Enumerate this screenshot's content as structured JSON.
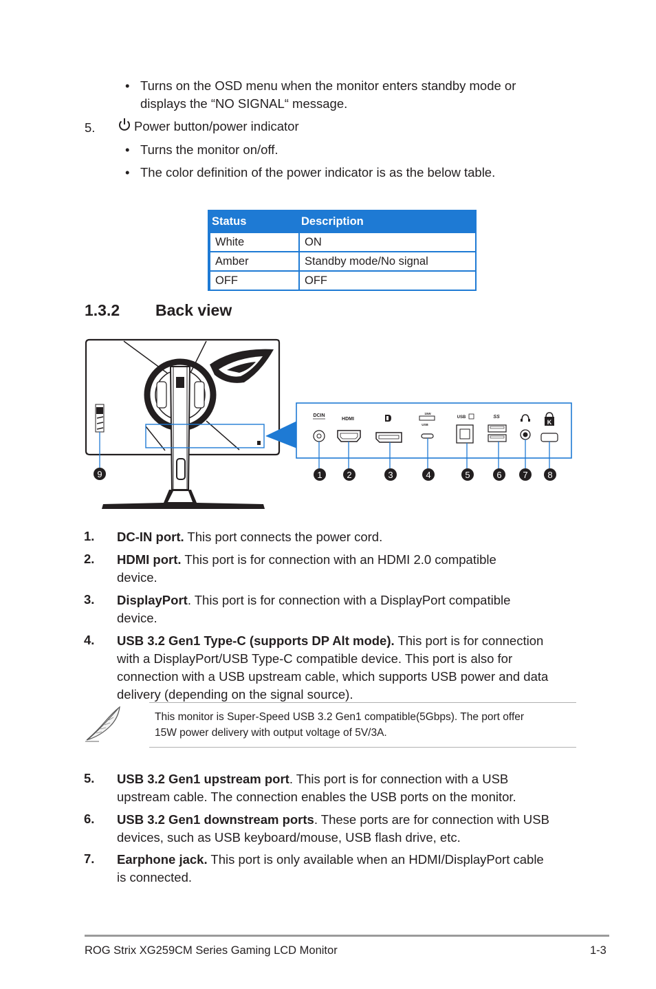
{
  "top_bullets": [
    {
      "symbol": "•",
      "lines": [
        "Turns on the OSD menu when the monitor enters standby mode or",
        "displays the “NO SIGNAL“ message."
      ]
    }
  ],
  "power_item": {
    "number": "5.",
    "icon": "power-icon",
    "label": "Power button/power indicator",
    "bullets": [
      {
        "symbol": "•",
        "text": "Turns the monitor on/off."
      },
      {
        "symbol": "•",
        "text": "The color definition of the power indicator is as the below table."
      }
    ]
  },
  "status_table": {
    "header": [
      "Status",
      "Description"
    ],
    "rows": [
      [
        "White",
        "ON"
      ],
      [
        "Amber",
        "Standby mode/No signal"
      ],
      [
        "OFF",
        "OFF"
      ]
    ],
    "header_color": "#1e7ad4"
  },
  "section": {
    "number": "1.3.2",
    "title": "Back view"
  },
  "diagram": {
    "port_labels": {
      "dcin": "DCIN",
      "hdmi": "HDMI",
      "dp": "DP",
      "typec_top": "15W",
      "typec_bottom": "USB",
      "usb_up": "USB",
      "usb_ss": "SS"
    },
    "callouts": [
      "1",
      "2",
      "3",
      "4",
      "5",
      "6",
      "7",
      "8",
      "9"
    ]
  },
  "items": [
    {
      "number": "1.",
      "bold": "DC-IN port.",
      "lines": [
        " This port connects the power cord."
      ]
    },
    {
      "number": "2.",
      "bold": "HDMI port.",
      "lines": [
        " This port is for connection with an HDMI 2.0 compatible",
        "device."
      ]
    },
    {
      "number": "3.",
      "bold": "DisplayPort",
      "lines": [
        ". This port is for connection with a DisplayPort compatible",
        "device."
      ]
    },
    {
      "number": "4.",
      "bold": "USB 3.2 Gen1 Type-C (supports DP Alt mode).",
      "lines": [
        " This port is for connection",
        "with a DisplayPort/USB Type-C compatible device. This port is also for",
        "connection with a USB upstream cable, which supports USB power and data",
        "delivery (depending on the signal source)."
      ]
    },
    {
      "number": "5.",
      "bold": "USB 3.2 Gen1 upstream port",
      "lines": [
        ". This port is for connection with a USB",
        "upstream cable. The connection enables the USB ports on the monitor."
      ]
    },
    {
      "number": "6.",
      "bold": "USB 3.2 Gen1 downstream ports",
      "lines": [
        ". These ports are for connection with USB",
        "devices, such as  USB keyboard/mouse, USB flash drive, etc."
      ]
    },
    {
      "number": "7.",
      "bold": "Earphone jack.",
      "lines": [
        " This port is only available when an HDMI/DisplayPort cable",
        "is connected."
      ]
    }
  ],
  "note": {
    "icon": "feather-pen-icon",
    "lines": [
      "This monitor is Super-Speed USB 3.2 Gen1 compatible(5Gbps). The port offer",
      "15W power delivery with output voltage of 5V/3A."
    ]
  },
  "footer": {
    "title": "ROG Strix XG259CM Series Gaming LCD Monitor",
    "page": "1-3"
  }
}
